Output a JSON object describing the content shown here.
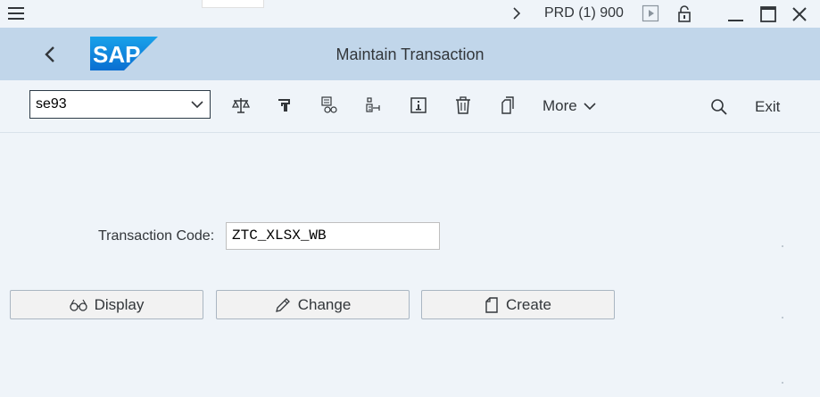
{
  "topbar": {
    "system_label": "PRD (1) 900"
  },
  "header": {
    "logo_text": "SAP",
    "title": "Maintain Transaction"
  },
  "toolbar": {
    "command_value": "se93",
    "more_label": "More",
    "exit_label": "Exit",
    "icons": [
      "compare-icon",
      "where-used-icon",
      "display-object-list-icon",
      "hierarchy-icon",
      "info-icon",
      "delete-icon",
      "copy-icon",
      "search-icon"
    ]
  },
  "form": {
    "transaction_code_label": "Transaction Code:",
    "transaction_code_value": "ZTC_XLSX_WB"
  },
  "buttons": {
    "display_label": "Display",
    "change_label": "Change",
    "create_label": "Create"
  },
  "colors": {
    "header_bg": "#c1d6ea",
    "page_bg": "#eff4f9",
    "sap_blue": "#0a6ed1",
    "icon": "#32363a"
  }
}
